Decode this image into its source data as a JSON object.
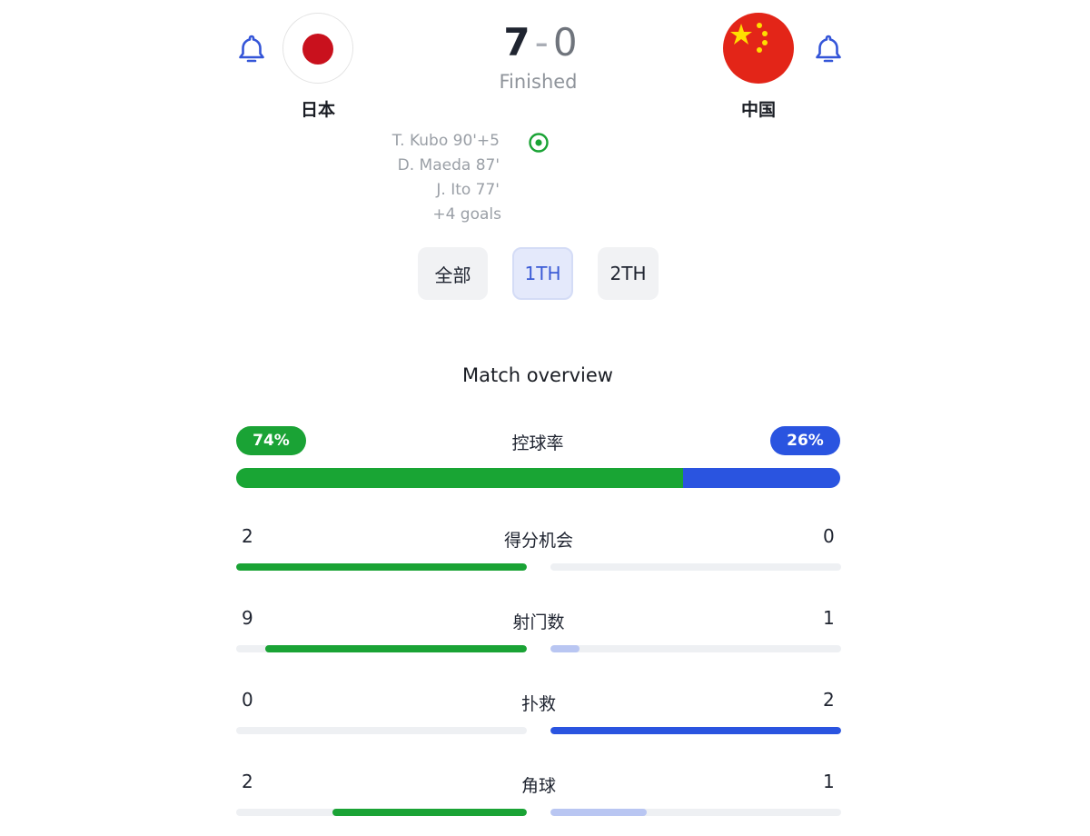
{
  "match": {
    "home": {
      "name": "日本",
      "flag": "japan-flag"
    },
    "away": {
      "name": "中国",
      "flag": "china-flag"
    },
    "score_home": "7",
    "score_sep": "-",
    "score_away": "0",
    "status": "Finished",
    "scorers": [
      "T. Kubo 90'+5",
      "D. Maeda 87'",
      "J. Ito 77'",
      "+4 goals"
    ]
  },
  "periods": [
    {
      "label": "全部",
      "active": false
    },
    {
      "label": "1TH",
      "active": true
    },
    {
      "label": "2TH",
      "active": false
    }
  ],
  "overview": {
    "title": "Match overview",
    "possession": {
      "label": "控球率",
      "home_text": "74%",
      "away_text": "26%",
      "home": 74,
      "away": 26
    },
    "stats": [
      {
        "label": "得分机会",
        "home": "2",
        "away": "0",
        "home_fill": 1.0,
        "away_fill": 0.0,
        "away_color": "#c9d2f3"
      },
      {
        "label": "射门数",
        "home": "9",
        "away": "1",
        "home_fill": 0.9,
        "away_fill": 0.1,
        "away_color": "#b9c6f2"
      },
      {
        "label": "扑救",
        "home": "0",
        "away": "2",
        "home_fill": 0.0,
        "away_fill": 1.0,
        "away_color": "#2a54e0"
      },
      {
        "label": "角球",
        "home": "2",
        "away": "1",
        "home_fill": 0.67,
        "away_fill": 0.33,
        "away_color": "#b9c6f2"
      }
    ]
  },
  "colors": {
    "home_accent": "#1aa335",
    "away_accent": "#2a54e0",
    "bell": "#3455d8"
  }
}
